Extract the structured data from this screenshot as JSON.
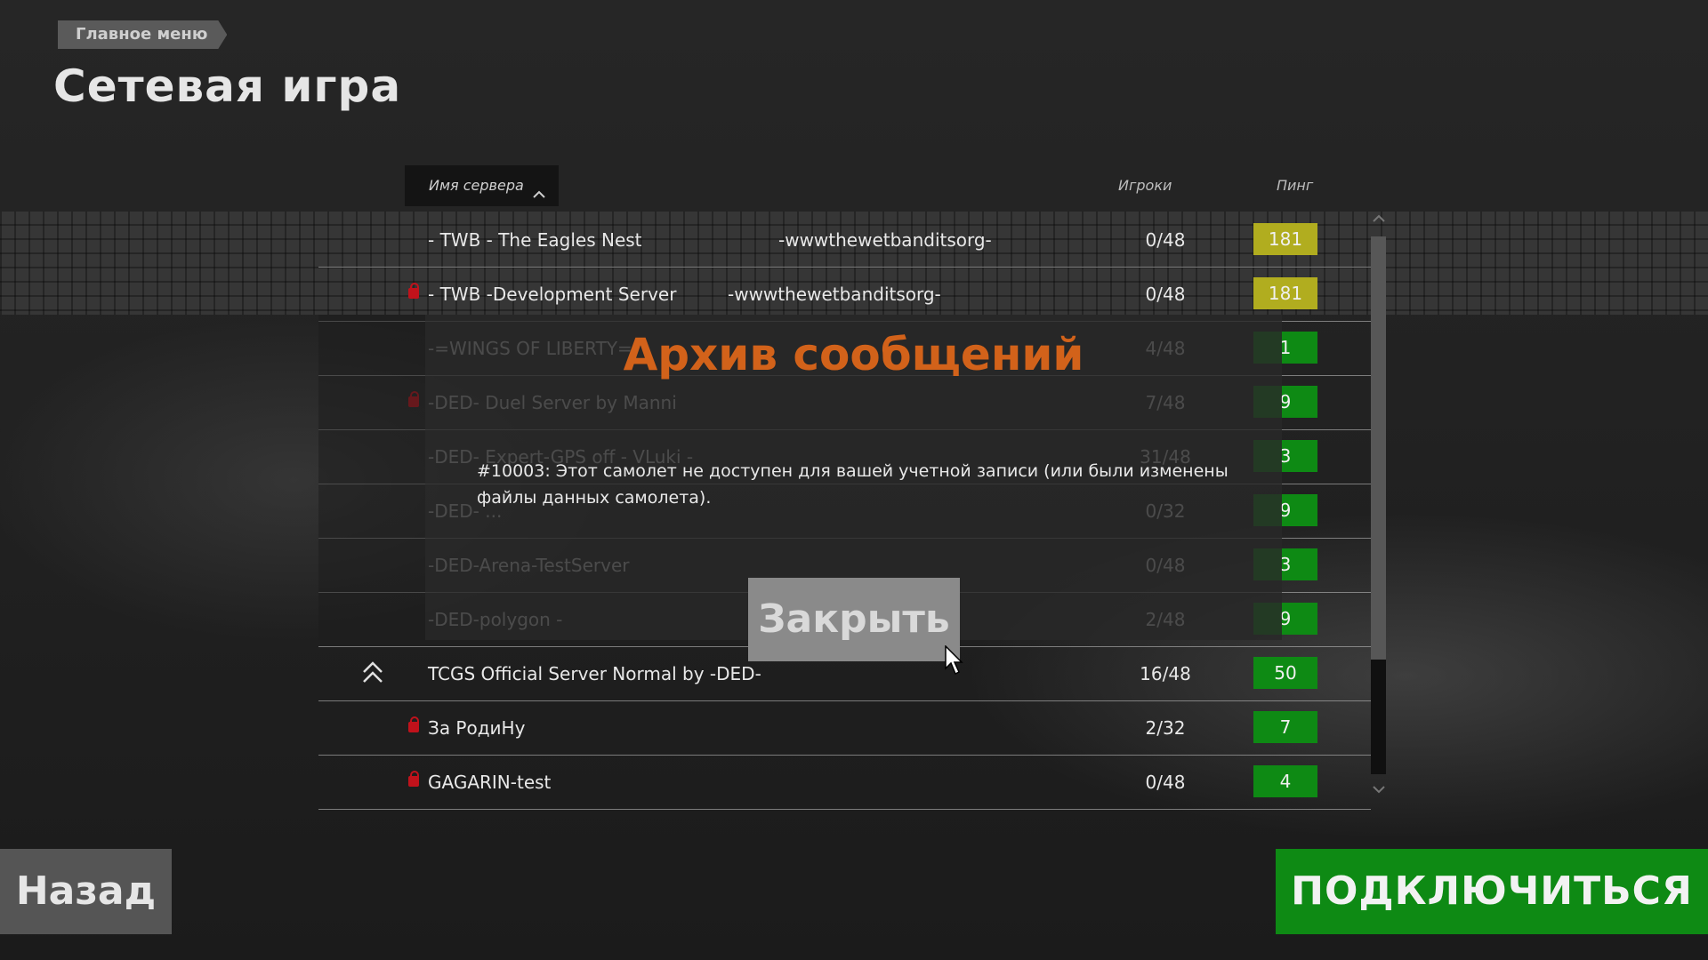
{
  "breadcrumb": "Главное меню",
  "page_title": "Сетевая игра",
  "list_header": {
    "server_name": "Имя сервера",
    "players": "Игроки",
    "ping": "Пинг"
  },
  "colors": {
    "ping_high": "#b1ad1f",
    "ping_low": "#0e8a14",
    "accent_title": "#d2621a",
    "connect": "#0e8a14",
    "lock": "#c0121b"
  },
  "servers": [
    {
      "locked": false,
      "name": "- TWB - The Eagles Nest",
      "desc": "-wwwthewetbanditsorg-",
      "players": "0/48",
      "ping": "181",
      "ping_level": "high"
    },
    {
      "locked": true,
      "name": "- TWB -Development Server",
      "desc": "-wwwthewetbanditsorg-",
      "players": "0/48",
      "ping": "181",
      "ping_level": "high"
    },
    {
      "locked": false,
      "name": "-=WINGS OF LIBERTY=-",
      "desc": "",
      "players": "4/48",
      "ping": "1",
      "ping_level": "low"
    },
    {
      "locked": true,
      "name": "-DED- Duel Server by Manni",
      "desc": "",
      "players": "7/48",
      "ping": "9",
      "ping_level": "low"
    },
    {
      "locked": false,
      "name": "-DED- Expert-GPS off - VLuki -",
      "desc": "",
      "players": "31/48",
      "ping": "3",
      "ping_level": "low"
    },
    {
      "locked": false,
      "name": "-DED- ...",
      "desc": "",
      "players": "0/32",
      "ping": "9",
      "ping_level": "low"
    },
    {
      "locked": false,
      "name": "-DED-Arena-TestServer",
      "desc": "",
      "players": "0/48",
      "ping": "3",
      "ping_level": "low"
    },
    {
      "locked": false,
      "name": "-DED-polygon -",
      "desc": "",
      "players": "2/48",
      "ping": "9",
      "ping_level": "low"
    },
    {
      "locked": false,
      "name": "TCGS Official Server Normal  by -DED-",
      "desc": "",
      "players": "16/48",
      "ping": "50",
      "ping_level": "low"
    },
    {
      "locked": true,
      "name": "За РодиНу",
      "desc": "",
      "players": "2/32",
      "ping": "7",
      "ping_level": "low"
    },
    {
      "locked": true,
      "name": "GAGARIN-test",
      "desc": "",
      "players": "0/48",
      "ping": "4",
      "ping_level": "low"
    }
  ],
  "dialog": {
    "title": "Архив сообщений",
    "message": "#10003: Этот самолет не доступен для вашей учетной записи (или были изменены файлы данных самолета).",
    "close_label": "Закрыть"
  },
  "buttons": {
    "back": "Назад",
    "connect": "ПОДКЛЮЧИТЬСЯ"
  }
}
